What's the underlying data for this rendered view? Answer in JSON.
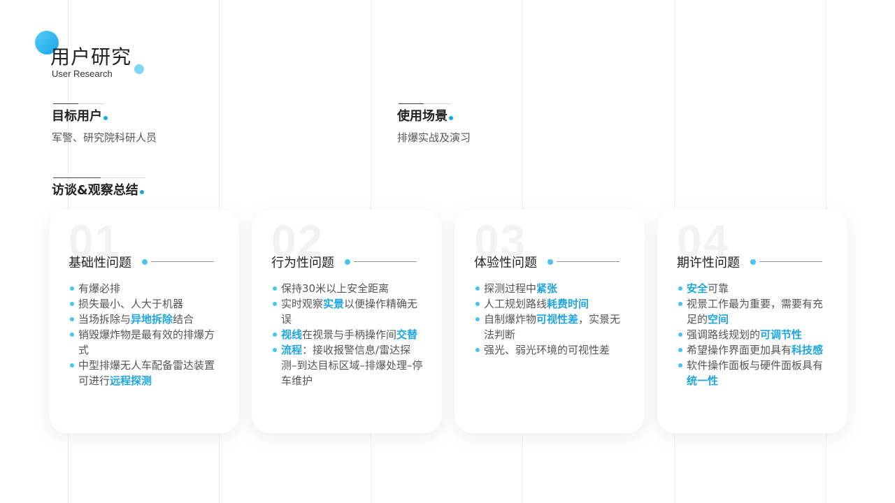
{
  "header": {
    "title": "用户研究",
    "subtitle": "User Research"
  },
  "sections": {
    "target_users": {
      "heading": "目标用户",
      "text": "军警、研究院科研人员"
    },
    "use_scenario": {
      "heading": "使用场景",
      "text": "排爆实战及演习"
    },
    "summary": {
      "heading": "访谈&观察总结"
    }
  },
  "colors": {
    "accent": "#1fa6e0",
    "accent_light": "#49c3ee"
  },
  "cards": [
    {
      "number": "01",
      "title": "基础性问题",
      "items": [
        [
          {
            "t": "有爆必排",
            "h": false
          }
        ],
        [
          {
            "t": "损失最小、人大于机器",
            "h": false
          }
        ],
        [
          {
            "t": "当场拆除与",
            "h": false
          },
          {
            "t": "异地拆除",
            "h": true
          },
          {
            "t": "结合",
            "h": false
          }
        ],
        [
          {
            "t": "销毁爆炸物是最有效的排爆方式",
            "h": false
          }
        ],
        [
          {
            "t": "中型排爆无人车配备雷达装置可进行",
            "h": false
          },
          {
            "t": "远程探测",
            "h": true
          }
        ]
      ]
    },
    {
      "number": "02",
      "title": "行为性问题",
      "items": [
        [
          {
            "t": "保持30米以上安全距离",
            "h": false
          }
        ],
        [
          {
            "t": "实时观察",
            "h": false
          },
          {
            "t": "实景",
            "h": true
          },
          {
            "t": "以便操作精确无误",
            "h": false
          }
        ],
        [
          {
            "t": "视线",
            "h": true
          },
          {
            "t": "在视景与手柄操作间",
            "h": false
          },
          {
            "t": "交替",
            "h": true
          }
        ],
        [
          {
            "t": "流程",
            "h": true
          },
          {
            "t": "：接收报警信息/雷达探测–到达目标区域–排爆处理–停车维护",
            "h": false
          }
        ]
      ]
    },
    {
      "number": "03",
      "title": "体验性问题",
      "items": [
        [
          {
            "t": "探测过程中",
            "h": false
          },
          {
            "t": "紧张",
            "h": true
          }
        ],
        [
          {
            "t": "人工规划路线",
            "h": false
          },
          {
            "t": "耗费时间",
            "h": true
          }
        ],
        [
          {
            "t": "自制爆炸物",
            "h": false
          },
          {
            "t": "可视性差",
            "h": true
          },
          {
            "t": "，实景无法判断",
            "h": false
          }
        ],
        [
          {
            "t": "强光、弱光环境的可视性差",
            "h": false
          }
        ]
      ]
    },
    {
      "number": "04",
      "title": "期许性问题",
      "items": [
        [
          {
            "t": "安全",
            "h": true
          },
          {
            "t": "可靠",
            "h": false
          }
        ],
        [
          {
            "t": "视景工作最为重要，需要有充足的",
            "h": false
          },
          {
            "t": "空间",
            "h": true
          }
        ],
        [
          {
            "t": "强调路线规划的",
            "h": false
          },
          {
            "t": "可调节性",
            "h": true
          }
        ],
        [
          {
            "t": "希望操作界面更加具有",
            "h": false
          },
          {
            "t": "科技感",
            "h": true
          }
        ],
        [
          {
            "t": "软件操作面板与硬件面板具有",
            "h": false
          },
          {
            "t": "统一性",
            "h": true
          }
        ]
      ]
    }
  ]
}
